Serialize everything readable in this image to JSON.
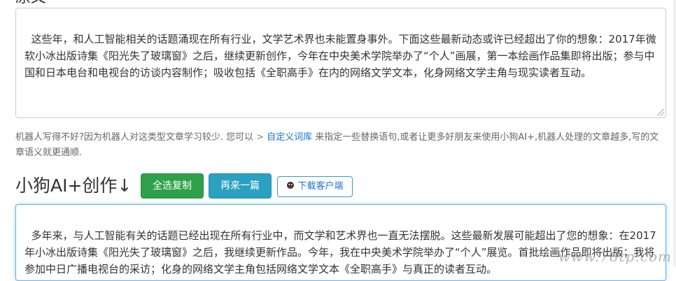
{
  "source": {
    "text": "这些年，和人工智能相关的话题涌现在所有行业，文学艺术界也未能置身事外。下面这些最新动态或许已经超出了你的想象：2017年微软小冰出版诗集《阳光失了玻璃窗》之后，继续更新创作，今年在中央美术学院举办了“个人”画展，第一本绘画作品集即将出版；参与中国和日本电台和电视台的访谈内容制作；吸收包括《全职高手》在内的网络文学文本，化身网络文学主角与现实读者互动。"
  },
  "hint": {
    "text_before": "机器人写得不好?因为机器人对这类型文章学习较少. 您可以",
    "arrow": ">",
    "link_label": "自定义词库",
    "text_after": "来指定一些替换语句,或者让更多好朋友来使用小狗AI+,机器人处理的文章越多,写的文章语义就更通顺."
  },
  "section": {
    "title": "小狗AI+创作↓"
  },
  "buttons": {
    "copy_label": "全选复制",
    "again_label": "再来一篇",
    "download_label": "下载客户端"
  },
  "output": {
    "text": "多年来，与人工智能有关的话题已经出现在所有行业中，而文学和艺术界也一直无法摆脱。这些最新发展可能超出了您的想象：在2017年小冰出版诗集《阳光失了玻璃窗》之后，我继续更新作品。今年，我在中央美术学院举办了“个人”展览。首批绘画作品即将出版；我将参加中日广播电视台的采访；化身的网络文学主角包括网络文学文本《全职高手》与真正的读者互动。"
  },
  "watermark": {
    "text": "www.78tp.com"
  },
  "colors": {
    "copy_button": "#2ea04a",
    "again_button": "#2aa1c0",
    "link": "#1a73c8",
    "focus_border": "#66afe9"
  }
}
